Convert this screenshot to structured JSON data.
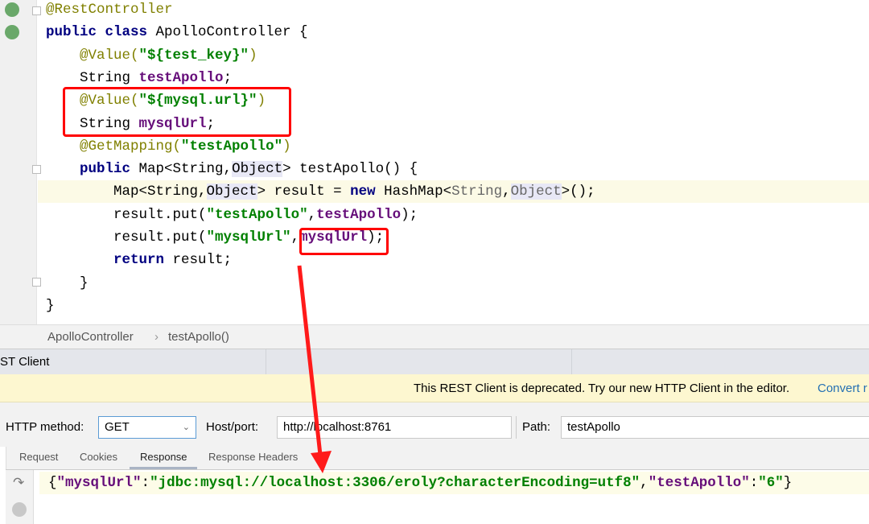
{
  "editor": {
    "lines": [
      [
        [
          "@RestController",
          "ann"
        ]
      ],
      [
        [
          "public class ",
          "kw"
        ],
        [
          "ApolloController {",
          "plain"
        ]
      ],
      [
        [
          "    ",
          "plain"
        ],
        [
          "@Value(",
          "ann"
        ],
        [
          "\"${test_key}\"",
          "str"
        ],
        [
          ")",
          "ann"
        ]
      ],
      [
        [
          "    String ",
          "plain"
        ],
        [
          "testApollo",
          "fld"
        ],
        [
          ";",
          "plain"
        ]
      ],
      [
        [
          "    ",
          "plain"
        ],
        [
          "@Value(",
          "ann"
        ],
        [
          "\"${mysql.url}\"",
          "str"
        ],
        [
          ")",
          "ann"
        ]
      ],
      [
        [
          "    String ",
          "plain"
        ],
        [
          "mysqlUrl",
          "fld"
        ],
        [
          ";",
          "plain"
        ]
      ],
      [
        [
          "    ",
          "plain"
        ],
        [
          "@GetMapping(",
          "ann"
        ],
        [
          "\"testApollo\"",
          "str"
        ],
        [
          ")",
          "ann"
        ]
      ],
      [
        [
          "    ",
          "plain"
        ],
        [
          "public ",
          "kw"
        ],
        [
          "Map<String,",
          "plain"
        ],
        [
          "Object",
          "ref"
        ],
        [
          "> testApollo() {",
          "plain"
        ]
      ],
      [
        [
          "        Map<String,",
          "plain"
        ],
        [
          "Object",
          "ref"
        ],
        [
          "> result = ",
          "plain"
        ],
        [
          "new ",
          "kw"
        ],
        [
          "HashMap<",
          "plain"
        ],
        [
          "String",
          "gray"
        ],
        [
          ",",
          "plain"
        ],
        [
          "Object",
          "ref gray"
        ],
        [
          ">();",
          "plain"
        ]
      ],
      [
        [
          "        result.put(",
          "plain"
        ],
        [
          "\"testApollo\"",
          "str"
        ],
        [
          ",",
          "plain"
        ],
        [
          "testApollo",
          "fld"
        ],
        [
          ");",
          "plain"
        ]
      ],
      [
        [
          "        result.put(",
          "plain"
        ],
        [
          "\"mysqlUrl\"",
          "str"
        ],
        [
          ",",
          "plain"
        ],
        [
          "mysqlUrl",
          "fld"
        ],
        [
          ");",
          "plain"
        ]
      ],
      [
        [
          "        ",
          "plain"
        ],
        [
          "return ",
          "kw"
        ],
        [
          "result;",
          "plain"
        ]
      ],
      [
        [
          "    }",
          "plain"
        ]
      ],
      [
        [
          "}",
          "plain"
        ]
      ]
    ]
  },
  "breadcrumb": {
    "class": "ApolloController",
    "sep": "›",
    "method": "testApollo()"
  },
  "tool_window": {
    "title": "ST Client"
  },
  "banner": {
    "text": "This REST Client is deprecated. Try our new HTTP Client in the editor.",
    "link": "Convert r"
  },
  "form": {
    "method_label": "HTTP method:",
    "method_value": "GET",
    "host_label": "Host/port:",
    "host_value": "http://localhost:8761",
    "path_label": "Path:",
    "path_value": "testApollo"
  },
  "tabs": [
    "Request",
    "Cookies",
    "Response",
    "Response Headers"
  ],
  "response": {
    "tokens": [
      [
        "{",
        "plain"
      ],
      [
        "\"mysqlUrl\"",
        "fld"
      ],
      [
        ":",
        "plain"
      ],
      [
        "\"jdbc:mysql://localhost:3306/eroly?characterEncoding=utf8\"",
        "str"
      ],
      [
        ",",
        "plain"
      ],
      [
        "\"testApollo\"",
        "fld"
      ],
      [
        ":",
        "plain"
      ],
      [
        "\"6\"",
        "str"
      ],
      [
        "}",
        "plain"
      ]
    ]
  },
  "colors": {
    "annotation_box": "#ff0000",
    "link": "#2470b3"
  }
}
